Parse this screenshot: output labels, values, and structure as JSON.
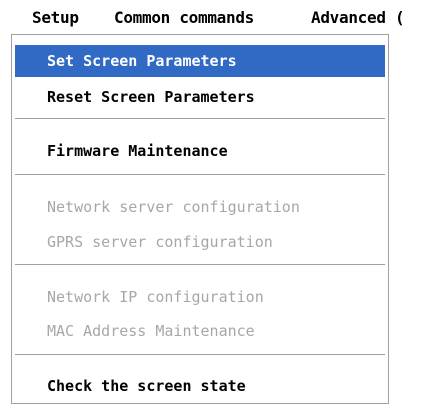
{
  "menubar": {
    "items": [
      {
        "label": "Setup"
      },
      {
        "label": "Common commands"
      },
      {
        "label": "Advanced ("
      }
    ]
  },
  "dropdown": {
    "items": [
      {
        "label": "Set Screen Parameters",
        "state": "selected"
      },
      {
        "label": "Reset Screen Parameters",
        "state": "enabled"
      },
      {
        "label": "Firmware Maintenance",
        "state": "enabled"
      },
      {
        "label": "Network server configuration",
        "state": "disabled"
      },
      {
        "label": "GPRS server configuration",
        "state": "disabled"
      },
      {
        "label": "Network IP configuration",
        "state": "disabled"
      },
      {
        "label": "MAC Address Maintenance",
        "state": "disabled"
      },
      {
        "label": "Check the screen state",
        "state": "enabled"
      }
    ]
  },
  "colors": {
    "highlight": "#316ac5",
    "highlight_text": "#ffffff",
    "disabled_text": "#a7a7a7",
    "separator": "#a0a0a0"
  }
}
